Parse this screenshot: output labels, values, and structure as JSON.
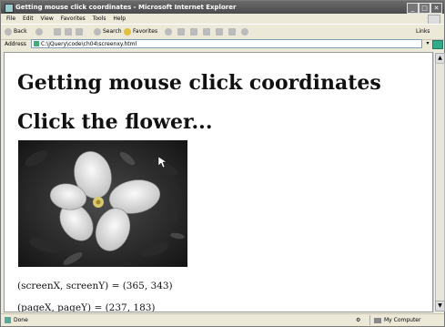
{
  "window": {
    "title": "Getting mouse click coordinates - Microsoft Internet Explorer",
    "controls": {
      "minimize": "_",
      "maximize": "□",
      "close": "✕"
    }
  },
  "menubar": {
    "items": [
      "File",
      "Edit",
      "View",
      "Favorites",
      "Tools",
      "Help"
    ]
  },
  "toolbar": {
    "back_label": "Back",
    "search_label": "Search",
    "favorites_label": "Favorites",
    "links_label": "Links"
  },
  "address": {
    "label": "Address",
    "value": "C:\\jQuery\\code\\ch04\\screenxy.html"
  },
  "page": {
    "heading1": "Getting mouse click coordinates",
    "heading2": "Click the flower...",
    "image_alt": "flower image",
    "coords_screen": "(screenX, screenY) = (365, 343)",
    "coords_page": "(pageX, pageY) = (237, 183)"
  },
  "statusbar": {
    "status": "Done",
    "zone": "My Computer"
  }
}
